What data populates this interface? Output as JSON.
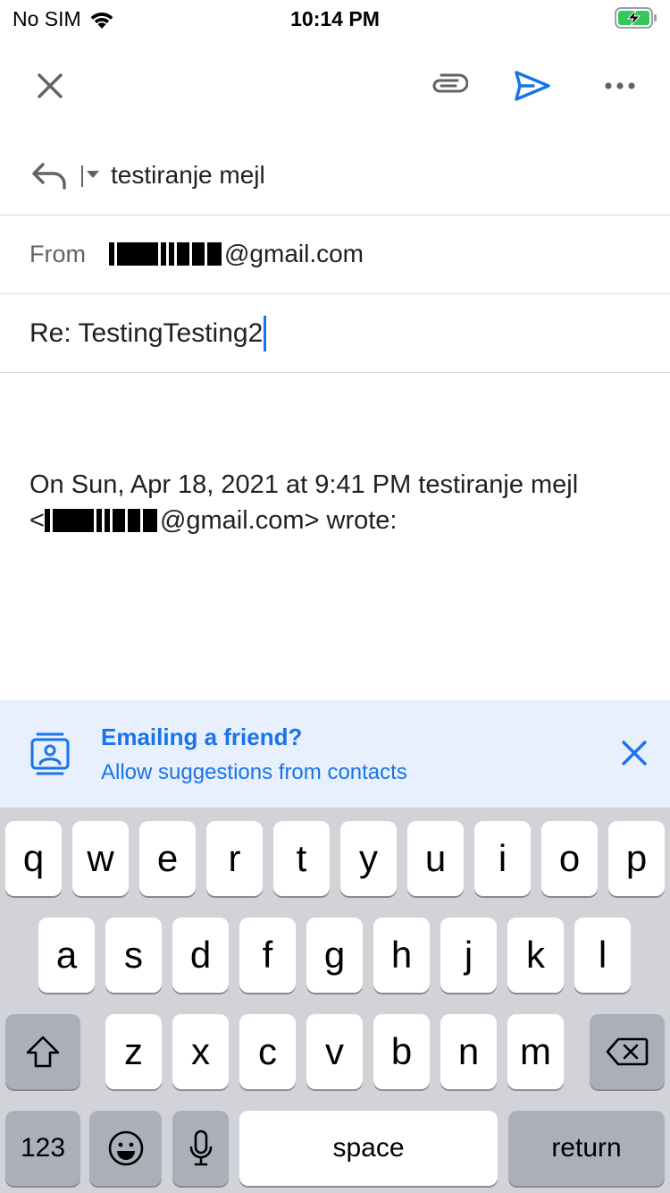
{
  "status_bar": {
    "carrier": "No SIM",
    "time": "10:14 PM"
  },
  "toolbar": {
    "close_icon": "close-icon",
    "attach_icon": "paperclip-icon",
    "send_icon": "send-icon",
    "more_icon": "more-horizontal-icon",
    "accent_color": "#1a73e8"
  },
  "compose": {
    "to_name": "testiranje mejl",
    "from_label": "From",
    "from_domain": "@gmail.com",
    "subject": "Re: TestingTesting2",
    "quote_line1": "On Sun, Apr 18, 2021 at 9:41 PM testiranje mejl",
    "quote_prefix": "<",
    "quote_suffix": "@gmail.com> wrote:"
  },
  "banner": {
    "title": "Emailing a friend?",
    "subtitle": "Allow suggestions from contacts",
    "background": "#e8f0fe"
  },
  "keyboard": {
    "row1": [
      "q",
      "w",
      "e",
      "r",
      "t",
      "y",
      "u",
      "i",
      "o",
      "p"
    ],
    "row2": [
      "a",
      "s",
      "d",
      "f",
      "g",
      "h",
      "j",
      "k",
      "l"
    ],
    "row3": [
      "z",
      "x",
      "c",
      "v",
      "b",
      "n",
      "m"
    ],
    "numbers_label": "123",
    "space_label": "space",
    "return_label": "return"
  }
}
